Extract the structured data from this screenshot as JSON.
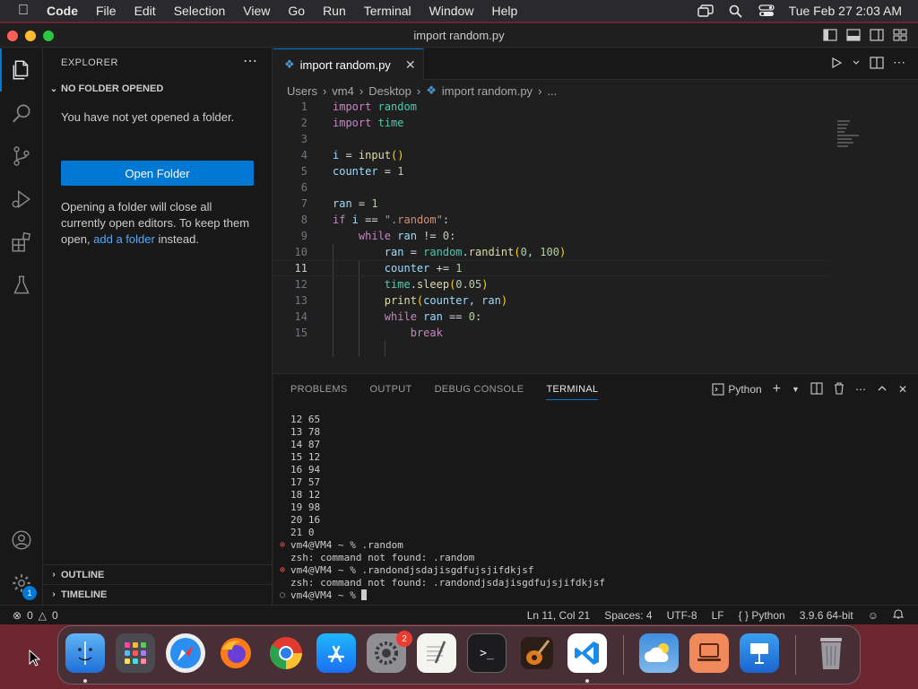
{
  "menubar": {
    "app": "Code",
    "items": [
      "File",
      "Edit",
      "Selection",
      "View",
      "Go",
      "Run",
      "Terminal",
      "Window",
      "Help"
    ],
    "clock": "Tue Feb 27  2:03 AM"
  },
  "window": {
    "title": "import random.py"
  },
  "sidebar": {
    "header": "EXPLORER",
    "section": "NO FOLDER OPENED",
    "message": "You have not yet opened a folder.",
    "open_button": "Open Folder",
    "note_1": "Opening a folder will close all currently open editors. To keep them open, ",
    "note_link": "add a folder",
    "note_2": " instead.",
    "outline": "OUTLINE",
    "timeline": "TIMELINE"
  },
  "editor": {
    "tab_label": "import random.py",
    "breadcrumb": [
      "Users",
      "vm4",
      "Desktop",
      "import random.py",
      "..."
    ],
    "current_line": 11
  },
  "panel": {
    "tabs": [
      "PROBLEMS",
      "OUTPUT",
      "DEBUG CONSOLE",
      "TERMINAL"
    ],
    "active_tab": "TERMINAL",
    "terminal_name": "Python",
    "output_lines": [
      {
        "mark": "",
        "text": "12 65"
      },
      {
        "mark": "",
        "text": "13 78"
      },
      {
        "mark": "",
        "text": "14 87"
      },
      {
        "mark": "",
        "text": "15 12"
      },
      {
        "mark": "",
        "text": "16 94"
      },
      {
        "mark": "",
        "text": "17 57"
      },
      {
        "mark": "",
        "text": "18 12"
      },
      {
        "mark": "",
        "text": "19 98"
      },
      {
        "mark": "",
        "text": "20 16"
      },
      {
        "mark": "",
        "text": "21 0"
      },
      {
        "mark": "err",
        "text": "vm4@VM4 ~ % .random"
      },
      {
        "mark": "",
        "text": "zsh: command not found: .random"
      },
      {
        "mark": "err",
        "text": "vm4@VM4 ~ % .randondjsdajisgdfujsjifdkjsf"
      },
      {
        "mark": "",
        "text": "zsh: command not found: .randondjsdajisgdfujsjifdkjsf"
      }
    ],
    "prompt": "vm4@VM4 ~ % "
  },
  "statusbar": {
    "errors": "0",
    "warnings": "0",
    "position": "Ln 11, Col 21",
    "spaces": "Spaces: 4",
    "encoding": "UTF-8",
    "eol": "LF",
    "language": "Python",
    "interpreter": "3.9.6 64-bit"
  },
  "dock": {
    "settings_badge": "2"
  },
  "activity": {
    "accounts_badge": "1"
  },
  "colors": {
    "accent": "#0078d4",
    "keyword": "#c586c0",
    "function": "#dcdcaa",
    "number": "#b5cea8",
    "string": "#ce9178",
    "variable": "#9cdcfe"
  }
}
